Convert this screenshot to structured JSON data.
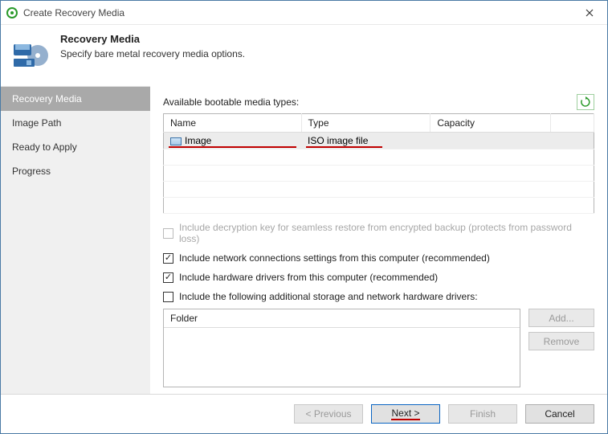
{
  "window": {
    "title": "Create Recovery Media"
  },
  "header": {
    "title": "Recovery Media",
    "subtitle": "Specify bare metal recovery media options."
  },
  "sidebar": {
    "items": [
      {
        "label": "Recovery Media",
        "active": true
      },
      {
        "label": "Image Path",
        "active": false
      },
      {
        "label": "Ready to Apply",
        "active": false
      },
      {
        "label": "Progress",
        "active": false
      }
    ]
  },
  "main": {
    "available_label": "Available bootable media types:",
    "refresh_icon": "refresh-icon",
    "media_table": {
      "columns": [
        "Name",
        "Type",
        "Capacity"
      ],
      "rows": [
        {
          "name": "Image",
          "type": "ISO image file",
          "capacity": "",
          "selected": true,
          "highlighted": true
        }
      ],
      "empty_rows": 4
    },
    "options": [
      {
        "checked": false,
        "disabled": true,
        "label": "Include decryption key for seamless restore from encrypted backup (protects from password loss)"
      },
      {
        "checked": true,
        "disabled": false,
        "label": "Include network connections settings from this computer (recommended)"
      },
      {
        "checked": true,
        "disabled": false,
        "label": "Include hardware drivers from this computer (recommended)"
      },
      {
        "checked": false,
        "disabled": false,
        "label": "Include the following additional storage and network hardware drivers:"
      }
    ],
    "folders": {
      "header": "Folder",
      "add_label": "Add...",
      "remove_label": "Remove"
    }
  },
  "footer": {
    "previous": "< Previous",
    "next": "Next >",
    "finish": "Finish",
    "cancel": "Cancel"
  }
}
